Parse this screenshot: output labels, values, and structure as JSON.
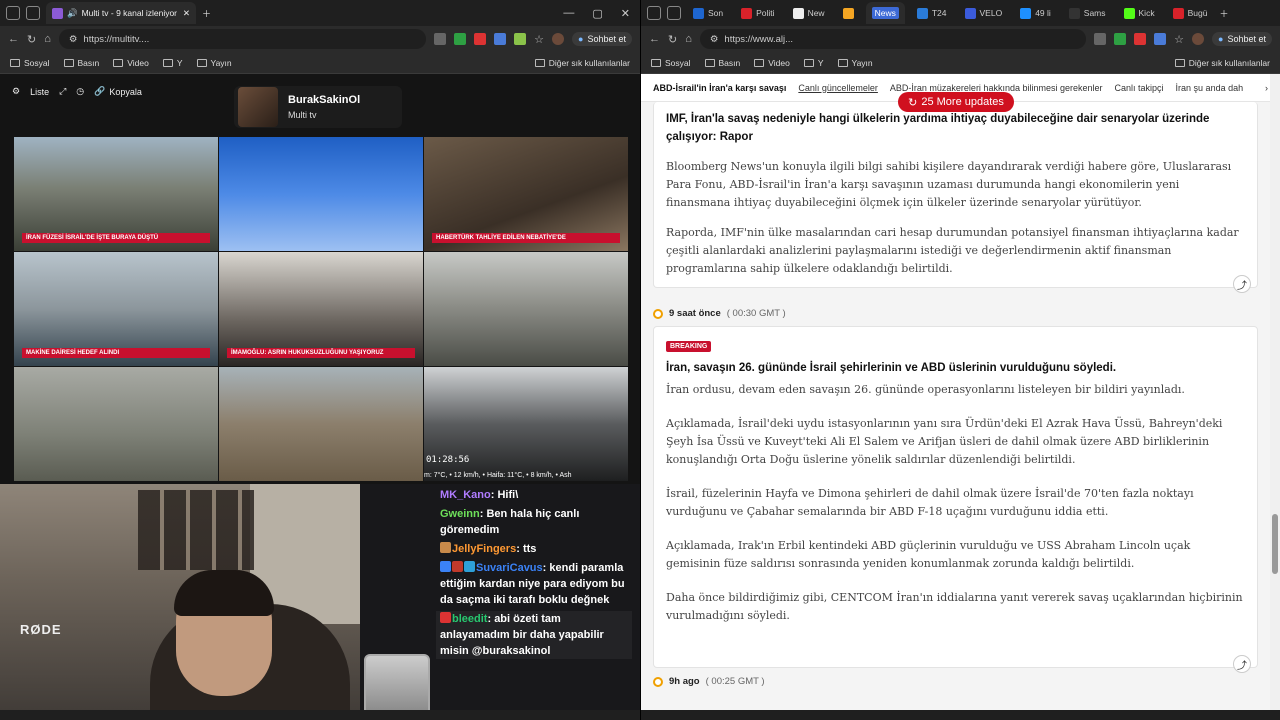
{
  "left_window": {
    "tab_title": "Multi tv - 9 kanal izleniyor",
    "url": "https://multitv....",
    "chat_button": "Sohbet et",
    "bookmarks": [
      "Sosyal",
      "Basın",
      "Video",
      "Y",
      "Yayın"
    ],
    "bookmarks_right": "Diğer sık kullanılanlar",
    "toolbar": {
      "list": "Liste",
      "copy": "Kopyala"
    },
    "profile": {
      "name": "BurakSakinOl",
      "subtitle": "Multi tv"
    },
    "tiles": [
      {
        "banner": "İRAN FÜZESİ İSRAİL'DE İŞTE BURAYA DÜŞTÜ"
      },
      {
        "banner": ""
      },
      {
        "banner": "HABERTÜRK TAHLİYE EDİLEN NEBATİYE'DE"
      },
      {
        "banner": "MAKİNE DAİRESİ HEDEF ALINDI"
      },
      {
        "banner": "İMAMOĞLU: ASRIN HUKUKSUZLUĞUNU YAŞIYORUZ"
      },
      {
        "banner": ""
      },
      {
        "banner": ""
      },
      {
        "banner": ""
      },
      {
        "banner": "",
        "clock": "01:28:56",
        "weather": "m: 7°C, • 12 km/h, • Haifa: 11°C, • 8 km/h, • Ash"
      }
    ],
    "webcam_mic": "RØDE",
    "chat": [
      {
        "user": "MK_Kano",
        "color": "#b07cff",
        "msg": "Hifi\\"
      },
      {
        "user": "Gweinn",
        "color": "#6ee05a",
        "msg": "Ben hala hiç canlı göremedim"
      },
      {
        "user": "JellyFingers",
        "color": "#ff9933",
        "msg": "tts"
      },
      {
        "user": "SuvariCavus",
        "color": "#3b82f6",
        "msg": "kendi paramla ettiğim kardan niye para ediyom bu da saçma iki tarafı boklu değnek"
      },
      {
        "user": "bleedit",
        "color": "#28c76f",
        "msg": "abi özeti tam anlayamadım bir daha yapabilir misin @buraksakinol"
      }
    ]
  },
  "right_window": {
    "tabs": [
      "Son",
      "Politi",
      "New",
      "",
      "News",
      "T24",
      "VELO",
      "49 li",
      "Sams",
      "Kick",
      "Bugü"
    ],
    "url": "https://www.alj...",
    "chat_button": "Sohbet et",
    "bookmarks": [
      "Sosyal",
      "Basın",
      "Video",
      "Y",
      "Yayın"
    ],
    "bookmarks_right": "Diğer sık kullanılanlar",
    "news_tabs": [
      "ABD-İsrail'in İran'a karşı savaşı",
      "Canlı güncellemeler",
      "ABD-İran müzakereleri hakkında bilinmesi gerekenler",
      "Canlı takipçi",
      "İran şu anda dah"
    ],
    "more_updates": "25 More updates",
    "post1": {
      "headline": "IMF, İran'la savaş nedeniyle hangi ülkelerin yardıma ihtiyaç duyabileceğine dair senaryolar üzerinde çalışıyor: Rapor",
      "p1": "Bloomberg News'un konuyla ilgili bilgi sahibi kişilere dayandırarak verdiği habere göre, Uluslararası Para Fonu, ABD-İsrail'in İran'a karşı savaşının uzaması durumunda hangi ekonomilerin yeni finansmana ihtiyaç duyabileceğini ölçmek için ülkeler üzerinde senaryolar yürütüyor.",
      "p2": "Raporda, IMF'nin ülke masalarından cari hesap durumundan potansiyel finansman ihtiyaçlarına kadar çeşitli alanlardaki analizlerini paylaşmalarını istediği ve değerlendirmenin aktif finansman programlarına sahip ülkelere odaklandığı belirtildi."
    },
    "time1": {
      "label": "9 saat önce",
      "gmt": "( 00:30 GMT )"
    },
    "post2": {
      "badge": "BREAKING",
      "headline": "İran, savaşın 26. gününde İsrail şehirlerinin ve ABD üslerinin vurulduğunu söyledi.",
      "p1": "İran ordusu, devam eden savaşın 26. gününde operasyonlarını listeleyen bir bildiri yayınladı.",
      "p2": "Açıklamada, İsrail'deki uydu istasyonlarının yanı sıra Ürdün'deki El Azrak Hava Üssü, Bahreyn'deki Şeyh İsa Üssü ve Kuveyt'teki Ali El Salem ve Arifjan üsleri de dahil olmak üzere ABD birliklerinin konuşlandığı Orta Doğu üslerine yönelik saldırılar düzenlendiği belirtildi.",
      "p3": "İsrail, füzelerinin Hayfa ve Dimona şehirleri de dahil olmak üzere İsrail'de 70'ten fazla noktayı vurduğunu ve Çabahar semalarında bir ABD F-18 uçağını vurduğunu iddia etti.",
      "p4": "Açıklamada, Irak'ın Erbil kentindeki ABD güçlerinin vurulduğu ve USS Abraham Lincoln uçak gemisinin füze saldırısı sonrasında yeniden konumlanmak zorunda kaldığı belirtildi.",
      "p5": "Daha önce bildirdiğimiz gibi, CENTCOM İran'ın iddialarına yanıt vererek savaş uçaklarından hiçbirinin vurulmadığını söyledi."
    },
    "time2": {
      "label": "9h ago",
      "gmt": "( 00:25 GMT )"
    }
  }
}
